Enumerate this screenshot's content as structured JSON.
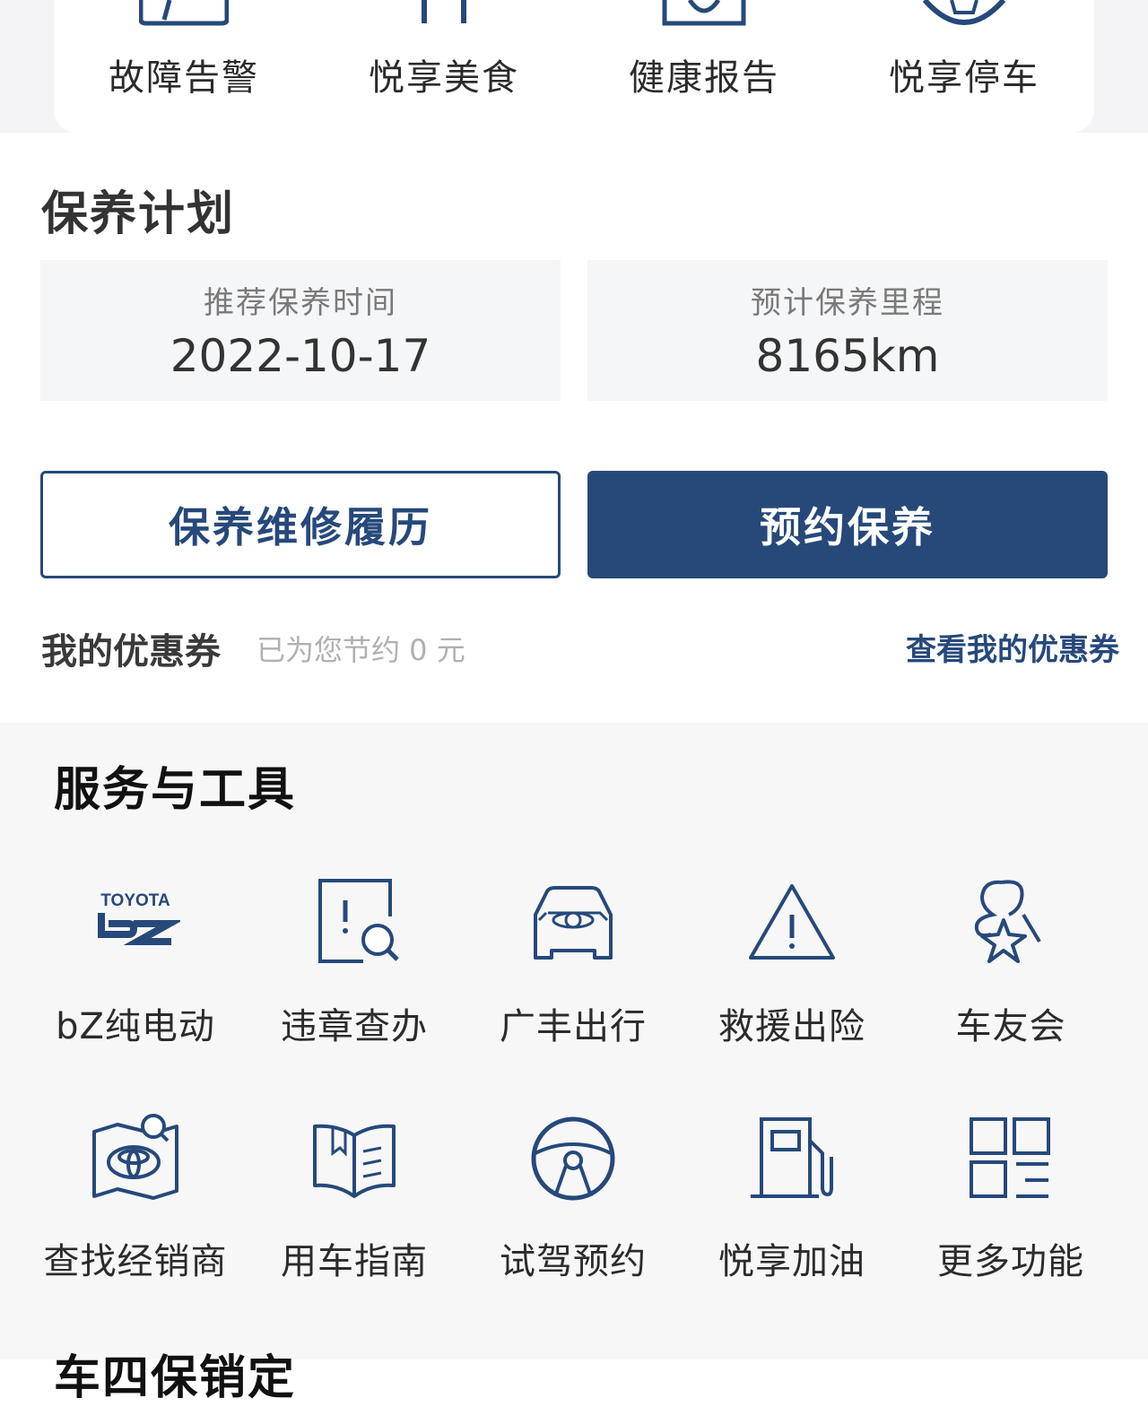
{
  "quick_actions": [
    {
      "label": "故障告警",
      "icon": "car-alert-icon"
    },
    {
      "label": "悦享美食",
      "icon": "dining-icon"
    },
    {
      "label": "健康报告",
      "icon": "health-report-icon"
    },
    {
      "label": "悦享停车",
      "icon": "parking-icon"
    }
  ],
  "maintenance": {
    "title": "保养计划",
    "recommended_time_label": "推荐保养时间",
    "recommended_time_value": "2022-10-17",
    "estimated_mileage_label": "预计保养里程",
    "estimated_mileage_value": "8165km",
    "history_button": "保养维修履历",
    "book_button": "预约保养"
  },
  "coupons": {
    "title": "我的优惠券",
    "saved_text": "已为您节约 0 元",
    "view_link": "查看我的优惠券"
  },
  "tools": {
    "title": "服务与工具",
    "items": [
      {
        "label": "bZ纯电动",
        "icon": "toyota-bz-logo-icon",
        "logo_text": "TOYOTA"
      },
      {
        "label": "违章查办",
        "icon": "violation-search-icon"
      },
      {
        "label": "广丰出行",
        "icon": "car-front-icon"
      },
      {
        "label": "救援出险",
        "icon": "warning-triangle-icon"
      },
      {
        "label": "车友会",
        "icon": "club-star-icon"
      },
      {
        "label": "查找经销商",
        "icon": "dealer-map-icon"
      },
      {
        "label": "用车指南",
        "icon": "guide-book-icon"
      },
      {
        "label": "试驾预约",
        "icon": "steering-wheel-icon"
      },
      {
        "label": "悦享加油",
        "icon": "fuel-pump-icon"
      },
      {
        "label": "更多功能",
        "icon": "more-grid-icon"
      }
    ]
  },
  "next_section_title": "车四保销定",
  "colors": {
    "brand": "#26497a",
    "section_bg": "#f7f7f8",
    "card_bg": "#f5f6f8"
  }
}
